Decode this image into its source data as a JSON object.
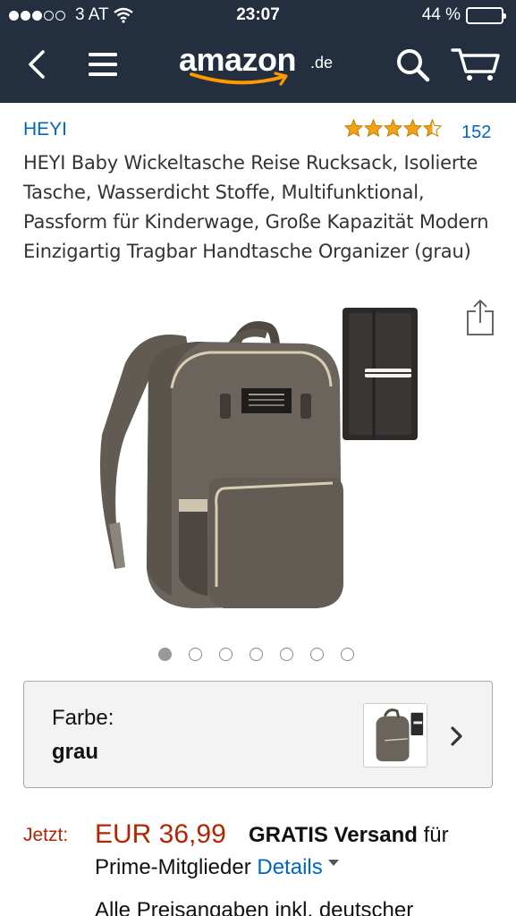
{
  "status_bar": {
    "signal_filled": 3,
    "signal_total": 5,
    "carrier": "3 AT",
    "time": "23:07",
    "battery_text": "44 %",
    "battery_level": 0.44
  },
  "nav": {
    "logo_word": "amazon",
    "logo_tld": ".de",
    "icons": [
      "back-chevron-icon",
      "menu-icon",
      "search-icon",
      "cart-icon"
    ]
  },
  "product": {
    "brand": "HEYI",
    "rating": 4.5,
    "review_count": "152",
    "title": "HEYI Baby Wickeltasche Reise Rucksack, Isolierte Tasche, Wasserdicht Stoffe, Multifunktional, Passform für Kinderwage, Große Kapazität Modern Einzigartig Tragbar Handtasche Organizer (grau)",
    "image_count": 7,
    "image_active_index": 0
  },
  "variant": {
    "label": "Farbe:",
    "value": "grau"
  },
  "price": {
    "now_label": "Jetzt:",
    "amount": "EUR 36,99",
    "shipping_bold": "GRATIS Versand",
    "shipping_rest": " für",
    "shipping_line2": "Prime-Mitglieder ",
    "details_link": "Details",
    "tax_note": "Alle Preisangaben inkl. deutscher"
  },
  "colors": {
    "header_bg": "#232f3e",
    "link": "#0066c0",
    "price": "#b12704",
    "star": "#f0a21b"
  }
}
